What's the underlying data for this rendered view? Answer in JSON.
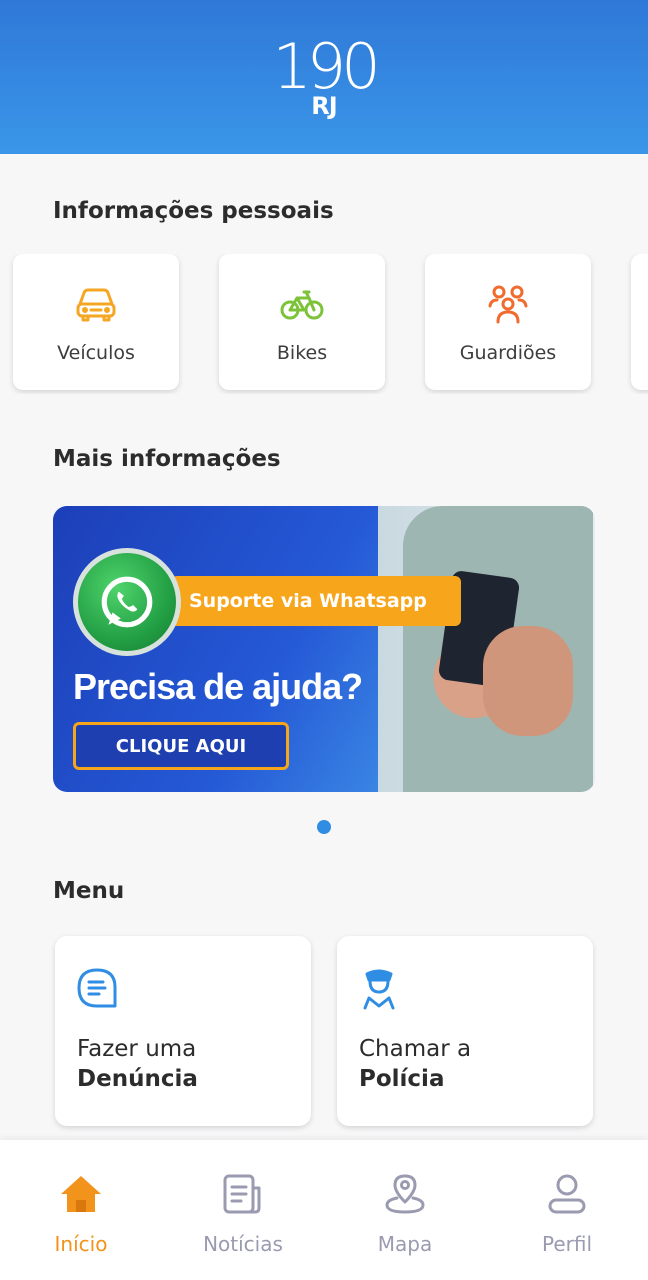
{
  "header": {
    "logo_number": "190",
    "logo_sub": "RJ"
  },
  "personal": {
    "title": "Informações pessoais",
    "items": [
      {
        "label": "Veículos",
        "icon": "car-icon",
        "color": "#f5a623"
      },
      {
        "label": "Bikes",
        "icon": "bike-icon",
        "color": "#7cc33a"
      },
      {
        "label": "Guardiões",
        "icon": "people-icon",
        "color": "#f26b2e"
      }
    ]
  },
  "more": {
    "title": "Mais informações",
    "banner": {
      "pill_text": "Suporte via Whatsapp",
      "headline": "Precisa de ajuda?",
      "cta_label": "CLIQUE AQUI"
    },
    "pagination_active": 1
  },
  "menu": {
    "title": "Menu",
    "items": [
      {
        "line1": "Fazer uma",
        "line2": "Denúncia",
        "icon": "chat-icon"
      },
      {
        "line1": "Chamar a",
        "line2": "Polícia",
        "icon": "police-icon"
      }
    ]
  },
  "nav": {
    "items": [
      {
        "label": "Início",
        "icon": "home-icon",
        "active": true
      },
      {
        "label": "Notícias",
        "icon": "news-icon",
        "active": false
      },
      {
        "label": "Mapa",
        "icon": "map-pin-icon",
        "active": false
      },
      {
        "label": "Perfil",
        "icon": "profile-icon",
        "active": false
      }
    ]
  },
  "colors": {
    "accent_blue": "#2f8de4",
    "accent_orange": "#f2931c",
    "nav_inactive": "#9a9bb0"
  }
}
